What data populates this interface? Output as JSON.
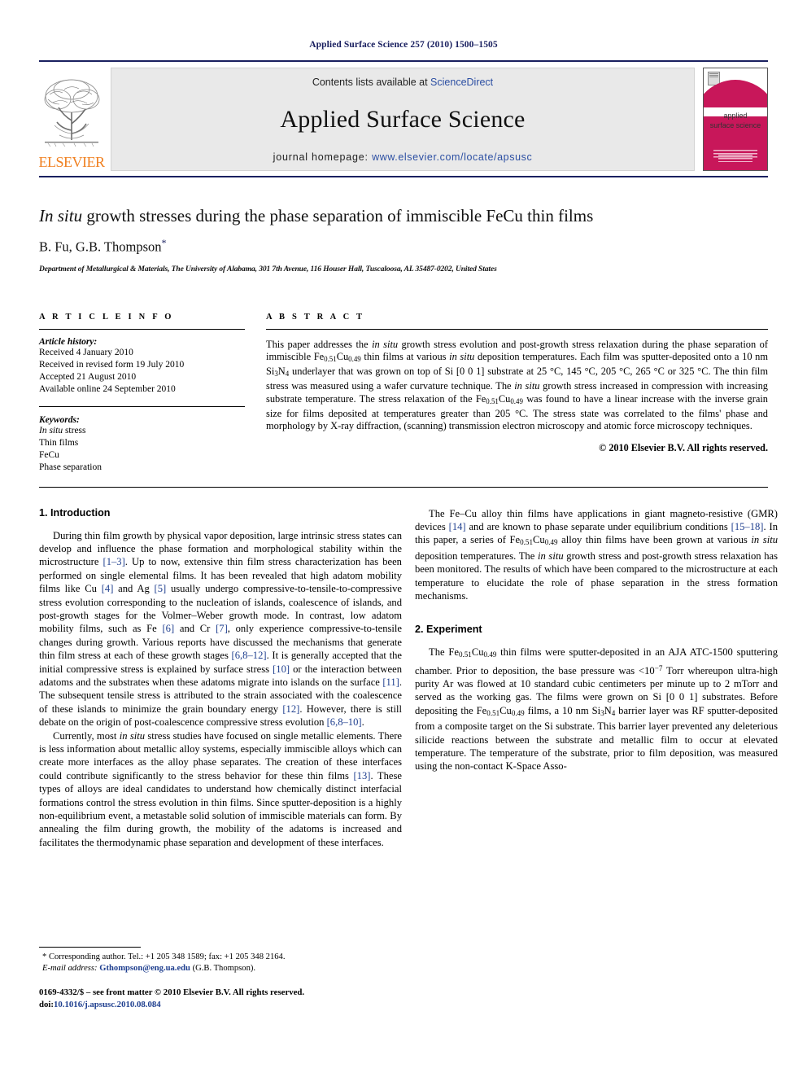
{
  "running_head": "Applied Surface Science 257 (2010) 1500–1505",
  "masthead": {
    "contents_prefix": "Contents lists available at ",
    "sciencedirect": "ScienceDirect",
    "journal_name": "Applied Surface Science",
    "homepage_prefix": "journal homepage:",
    "homepage_url": "www.elsevier.com/locate/apsusc",
    "publisher_wordmark": "ELSEVIER",
    "cover_title_line1": "applied",
    "cover_title_line2": "surface science",
    "accent_blue": "#1a2060",
    "link_blue": "#2b4ea2",
    "elsevier_orange": "#F08020",
    "cover_magenta": "#C8175A"
  },
  "title": {
    "italic_lead": "In situ",
    "rest": " growth stresses during the phase separation of immiscible FeCu thin films",
    "authors": "B. Fu, G.B. Thompson",
    "corresponding_marker": "*",
    "affiliation": "Department of Metallurgical & Materials, The University of Alabama, 301 7th Avenue, 116 Houser Hall, Tuscaloosa, AL 35487-0202, United States"
  },
  "article_info": {
    "label": "A R T I C L E    I N F O",
    "history_title": "Article history:",
    "history": [
      "Received 4 January 2010",
      "Received in revised form 19 July 2010",
      "Accepted 21 August 2010",
      "Available online 24 September 2010"
    ],
    "keywords_title": "Keywords:",
    "keywords": [
      "In situ stress",
      "Thin films",
      "FeCu",
      "Phase separation"
    ],
    "keyword_italic_first": "In situ",
    "keyword_italic_rest": " stress"
  },
  "abstract": {
    "label": "A B S T R A C T",
    "p1_a": "This paper addresses the ",
    "p1_i1": "in situ",
    "p1_b": " growth stress evolution and post-growth stress relaxation during the phase separation of immiscible Fe",
    "p1_sub1": "0.51",
    "p1_c": "Cu",
    "p1_sub2": "0.49",
    "p1_d": " thin films at various ",
    "p1_i2": "in situ",
    "p1_e": " deposition temperatures. Each film was sputter-deposited onto a 10 nm Si",
    "p1_sub3": "3",
    "p1_f": "N",
    "p1_sub4": "4",
    "p1_g": " underlayer that was grown on top of Si [0 0 1] substrate at 25 °C, 145 °C, 205 °C, 265 °C or 325 °C. The thin film stress was measured using a wafer curvature technique. The ",
    "p1_i3": "in situ",
    "p1_h": " growth stress increased in compression with increasing substrate temperature. The stress relaxation of the Fe",
    "p1_sub5": "0.51",
    "p1_j": "Cu",
    "p1_sub6": "0.49",
    "p1_k": " was found to have a linear increase with the inverse grain size for films deposited at temperatures greater than 205 °C. The stress state was correlated to the films' phase and morphology by X-ray diffraction, (scanning) transmission electron microscopy and atomic force microscopy techniques.",
    "copyright": "© 2010 Elsevier B.V. All rights reserved."
  },
  "sections": {
    "intro_heading": "1. Introduction",
    "experiment_heading": "2. Experiment"
  },
  "intro": {
    "p1_a": "During thin film growth by physical vapor deposition, large intrinsic stress states can develop and influence the phase formation and morphological stability within the microstructure ",
    "p1_c1": "[1–3]",
    "p1_b": ". Up to now, extensive thin film stress characterization has been performed on single elemental films. It has been revealed that high adatom mobility films like Cu ",
    "p1_c2": "[4]",
    "p1_c": " and Ag ",
    "p1_c3": "[5]",
    "p1_d": " usually undergo compressive-to-tensile-to-compressive stress evolution corresponding to the nucleation of islands, coalescence of islands, and post-growth stages for the Volmer–Weber growth mode. In contrast, low adatom mobility films, such as Fe ",
    "p1_c4": "[6]",
    "p1_e": " and Cr ",
    "p1_c5": "[7]",
    "p1_f": ", only experience compressive-to-tensile changes during growth. Various reports have discussed the mechanisms that generate thin film stress at each of these growth stages ",
    "p1_c6": "[6,8–12]",
    "p1_g": ". It is generally accepted that the initial compressive stress is explained by surface stress ",
    "p1_c7": "[10]",
    "p1_h": " or the interaction between adatoms and the substrates when these adatoms migrate into islands on the surface ",
    "p1_c8": "[11]",
    "p1_i": ". The subsequent tensile stress is attributed to the strain associated with the coalescence of these islands to minimize the grain boundary energy ",
    "p1_c9": "[12]",
    "p1_j": ". However, there is still debate on the origin of post-coalescence compressive stress evolution ",
    "p1_c10": "[6,8–10]",
    "p1_k": ".",
    "p2_a": "Currently, most ",
    "p2_i1": "in situ",
    "p2_b": " stress studies have focused on single metallic elements. There is less information about metallic alloy systems, especially immiscible alloys which can create more interfaces as the alloy phase separates. The creation of these interfaces could contribute significantly to the stress behavior for these thin films ",
    "p2_c1": "[13]",
    "p2_c": ". These types of alloys are ideal candidates to understand how chemically distinct interfacial formations control the stress evolution in thin films. Since sputter-deposition is a highly non-equilibrium event, a metastable solid solution of immiscible materials can form. By annealing the film during growth, the mobility of the adatoms is increased and facilitates the thermodynamic phase separation and development of these interfaces.",
    "p3_a": "The Fe–Cu alloy thin films have applications in giant magneto-resistive (GMR) devices ",
    "p3_c1": "[14]",
    "p3_b": " and are known to phase separate under equilibrium conditions ",
    "p3_c2": "[15–18]",
    "p3_c": ". In this paper, a series of Fe",
    "p3_sub1": "0.51",
    "p3_d": "Cu",
    "p3_sub2": "0.49",
    "p3_e": " alloy thin films have been grown at various ",
    "p3_i1": "in situ",
    "p3_f": " deposition temperatures. The ",
    "p3_i2": "in situ",
    "p3_g": " growth stress and post-growth stress relaxation has been monitored. The results of which have been compared to the microstructure at each temperature to elucidate the role of phase separation in the stress formation mechanisms."
  },
  "experiment": {
    "p1_a": "The Fe",
    "p1_sub1": "0.51",
    "p1_b": "Cu",
    "p1_sub2": "0.49",
    "p1_c": " thin films were sputter-deposited in an AJA ATC-1500 sputtering chamber. Prior to deposition, the base pressure was <10",
    "p1_sup1": "−7",
    "p1_d": " Torr whereupon ultra-high purity Ar was flowed at 10 standard cubic centimeters per minute up to 2 mTorr and served as the working gas. The films were grown on Si [0 0 1] substrates. Before depositing the Fe",
    "p1_sub3": "0.51",
    "p1_e": "Cu",
    "p1_sub4": "0.49",
    "p1_f": " films, a 10 nm Si",
    "p1_sub5": "3",
    "p1_g": "N",
    "p1_sub6": "4",
    "p1_h": " barrier layer was RF sputter-deposited from a composite target on the Si substrate. This barrier layer prevented any deleterious silicide reactions between the substrate and metallic film to occur at elevated temperature. The temperature of the substrate, prior to film deposition, was measured using the non-contact K-Space Asso-"
  },
  "footnote": {
    "star": "*",
    "line1": " Corresponding author. Tel.: +1 205 348 1589; fax: +1 205 348 2164.",
    "email_label": "E-mail address:",
    "email": "Gthompson@eng.ua.edu",
    "email_suffix": " (G.B. Thompson)."
  },
  "issn": {
    "line1": "0169-4332/$ – see front matter © 2010 Elsevier B.V. All rights reserved.",
    "doi_label": "doi:",
    "doi": "10.1016/j.apsusc.2010.08.084"
  }
}
